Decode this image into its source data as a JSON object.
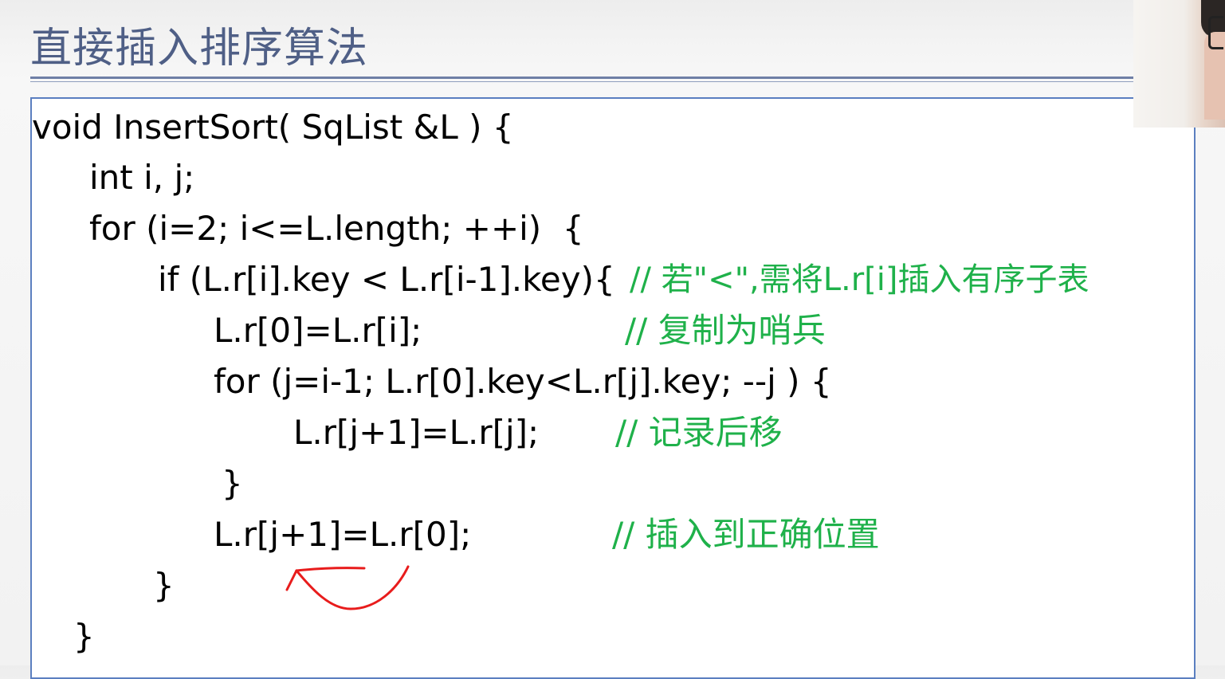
{
  "slide": {
    "title": "直接插入排序算法"
  },
  "code": {
    "line1": "void InsertSort( SqList &L ) {",
    "line2": "int i, j;",
    "line3": "for (i=2; i<=L.length; ++i)  {",
    "line4": "if (L.r[i].key < L.r[i-1].key){",
    "line4_comment": "// 若\"<\",需将L.r[i]插入有序子表",
    "line5": "L.r[0]=L.r[i];",
    "line5_comment": "// 复制为哨兵",
    "line6": "for (j=i-1; L.r[0].key<L.r[j].key; --j ) {",
    "line7": "L.r[j+1]=L.r[j];",
    "line7_comment": "// 记录后移",
    "line8": "}",
    "line9": "L.r[j+1]=L.r[0];",
    "line9_comment": "// 插入到正确位置",
    "line10": "}",
    "line11": "}"
  },
  "colors": {
    "title": "#4f5f86",
    "comment": "#1fb14a",
    "annotation": "#e81c1c",
    "box_border": "#5b7fc0"
  }
}
